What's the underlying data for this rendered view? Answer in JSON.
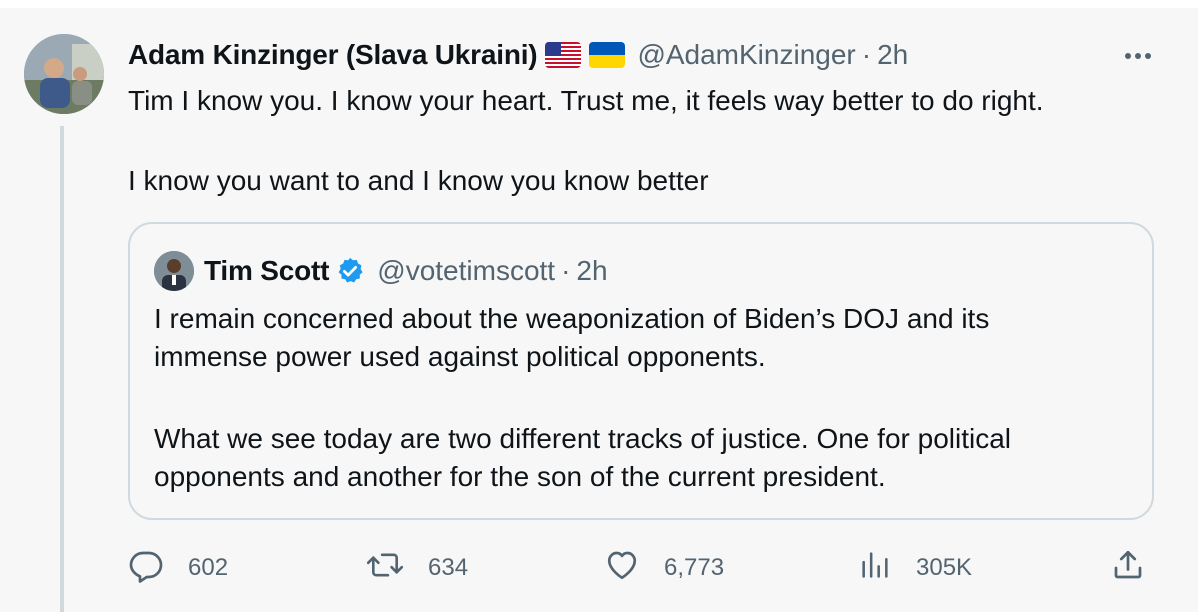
{
  "tweet": {
    "author_name": "Adam Kinzinger (Slava Ukraini)",
    "author_flags": [
      "us-flag-icon",
      "ukraine-flag-icon"
    ],
    "handle": "@AdamKinzinger",
    "separator": "·",
    "time": "2h",
    "text_line1": "Tim I know you.  I know your heart.  Trust me, it feels way better to do right.",
    "text_line2": "I know you want to and I know you know better"
  },
  "quoted": {
    "author_name": "Tim Scott",
    "verified_icon": "verified-badge-icon",
    "handle": "@votetimscott",
    "separator": "·",
    "time": "2h",
    "para1_line1": "I remain concerned about the weaponization of Biden’s DOJ and its",
    "para1_line2": "immense power used against political opponents.",
    "para2_line1": "What we see today are two different tracks of justice. One for political",
    "para2_line2": "opponents and another for the son of the current president."
  },
  "actions": {
    "replies": "602",
    "retweets": "634",
    "likes": "6,773",
    "views": "305K"
  },
  "colors": {
    "background": "#f7f7f7",
    "text_primary": "#0f1419",
    "text_secondary": "#536471",
    "border": "#cfd9de",
    "verified": "#1d9bf0"
  }
}
